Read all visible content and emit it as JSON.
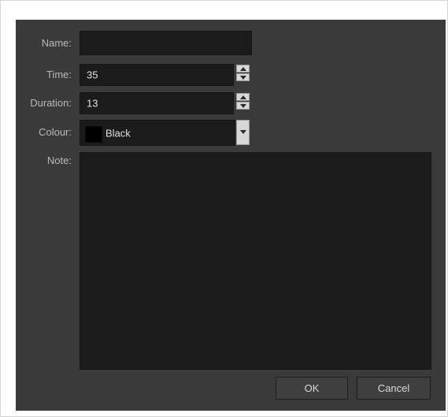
{
  "form": {
    "name_label": "Name:",
    "name_value": "",
    "time_label": "Time:",
    "time_value": "35",
    "duration_label": "Duration:",
    "duration_value": "13",
    "colour_label": "Colour:",
    "colour_value": "Black",
    "colour_swatch": "#000000",
    "note_label": "Note:",
    "note_value": ""
  },
  "buttons": {
    "ok": "OK",
    "cancel": "Cancel"
  }
}
